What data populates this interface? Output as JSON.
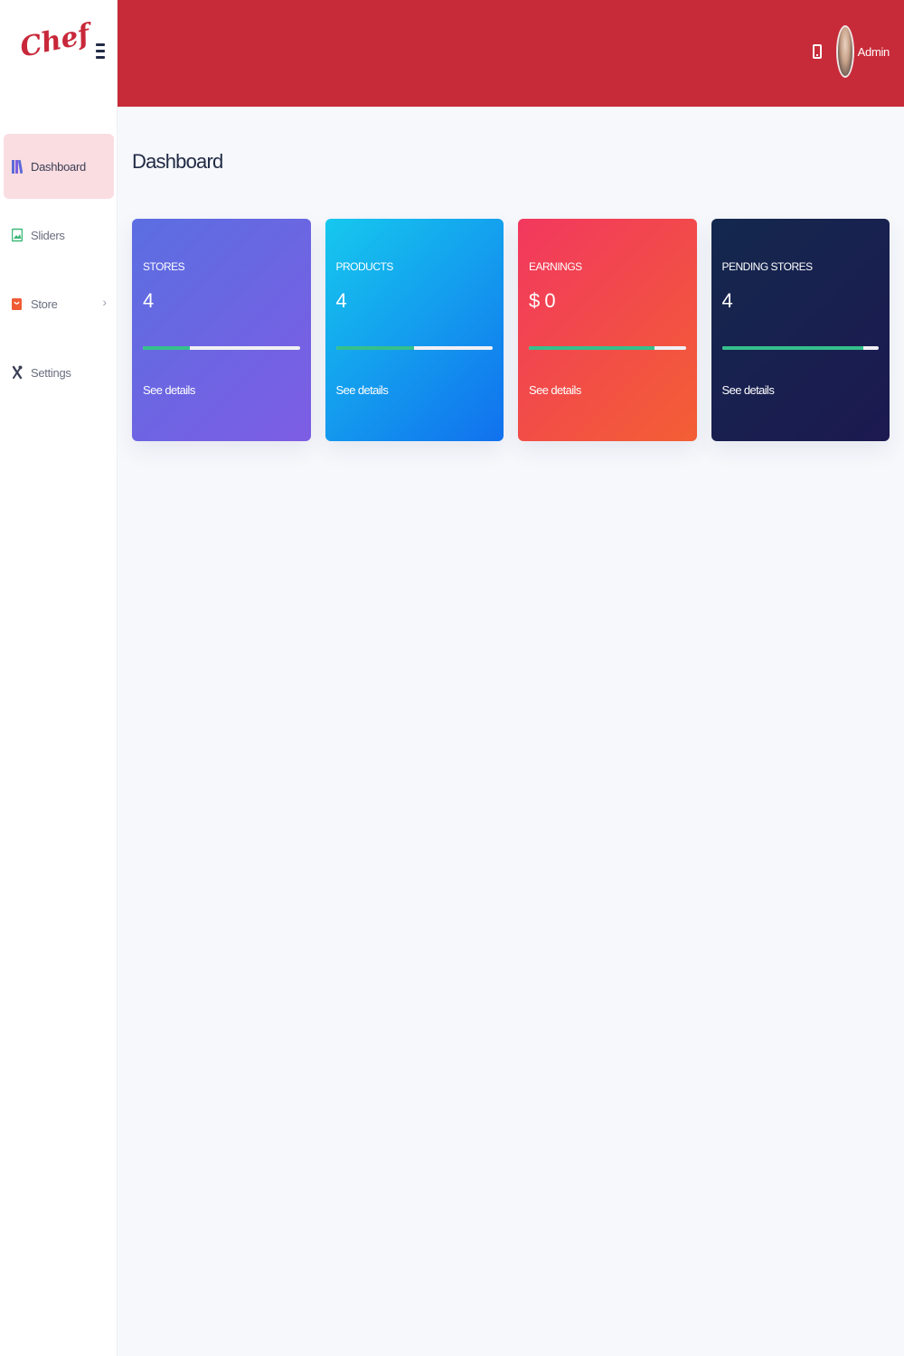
{
  "brand": {
    "logo_text": "Chef"
  },
  "header": {
    "user_name": "Admin"
  },
  "sidebar": {
    "items": [
      {
        "label": "Dashboard",
        "icon": "books-icon",
        "active": true
      },
      {
        "label": "Sliders",
        "icon": "image-icon"
      },
      {
        "label": "Store",
        "icon": "store-icon",
        "has_submenu": true
      },
      {
        "label": "Settings",
        "icon": "tools-icon"
      }
    ]
  },
  "main": {
    "title": "Dashboard",
    "cards": [
      {
        "label": "STORES",
        "value": "4",
        "progress": 0.3,
        "link": "See details"
      },
      {
        "label": "PRODUCTS",
        "value": "4",
        "progress": 0.5,
        "link": "See details"
      },
      {
        "label": "EARNINGS",
        "value": "$ 0",
        "progress": 0.8,
        "link": "See details"
      },
      {
        "label": "PENDING STORES",
        "value": "4",
        "progress": 0.9,
        "link": "See details"
      }
    ]
  },
  "colors": {
    "topbar": "#c72b39",
    "active_nav_bg": "#fadde1",
    "progress_fill": "#35c08c",
    "card_stores": [
      "#5b6ee2",
      "#7d5de3"
    ],
    "card_products": [
      "#16c8ee",
      "#1171ee"
    ],
    "card_earnings": [
      "#f2385e",
      "#f35f34"
    ],
    "card_pending": [
      "#14284e",
      "#1c1950"
    ]
  }
}
